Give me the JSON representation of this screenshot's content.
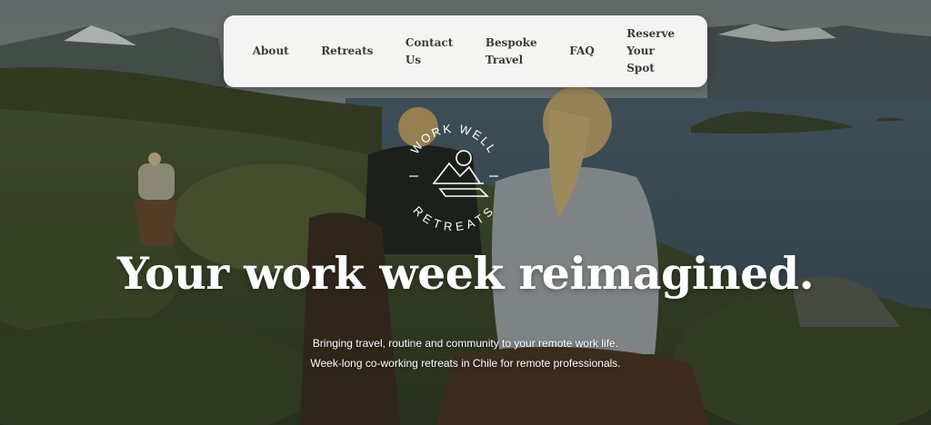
{
  "nav": {
    "items": [
      {
        "label": "About"
      },
      {
        "label": "Retreats"
      },
      {
        "label": "Contact\nUs"
      },
      {
        "label": "Bespoke\nTravel"
      },
      {
        "label": "FAQ"
      },
      {
        "label": "Reserve\nYour\nSpot"
      }
    ]
  },
  "logo": {
    "text_top": "WORK WELL",
    "text_bottom": "RETREATS"
  },
  "hero": {
    "headline": "Your work week reimagined.",
    "subline_1": "Bringing travel, routine and community to your remote work life.",
    "subline_2": "Week-long co-working retreats in Chile for remote professionals."
  },
  "colors": {
    "nav_bg": "#f4f4f2",
    "nav_text": "#3b3b36",
    "hero_text": "#ffffff"
  }
}
